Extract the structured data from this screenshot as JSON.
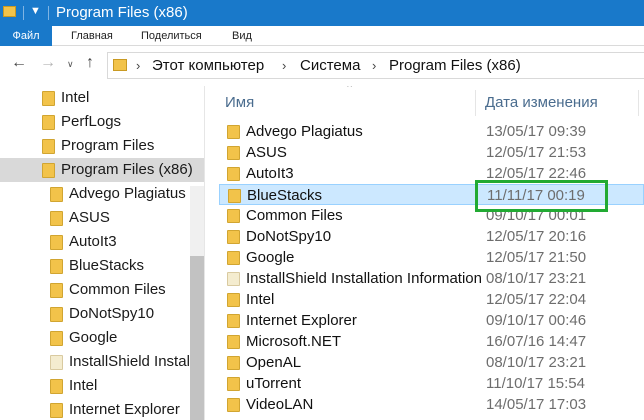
{
  "window": {
    "title": "Program Files (x86)"
  },
  "ribbon": {
    "tabs": [
      "Файл",
      "Главная",
      "Поделиться",
      "Вид"
    ]
  },
  "address": {
    "crumbs": [
      "Этот компьютер",
      "Система",
      "Program Files (x86)"
    ]
  },
  "nav_pane": {
    "items": [
      {
        "label": "Intel",
        "level": 0,
        "icon": "folder-icon"
      },
      {
        "label": "PerfLogs",
        "level": 0,
        "icon": "folder-icon"
      },
      {
        "label": "Program Files",
        "level": 0,
        "icon": "folder-icon"
      },
      {
        "label": "Program Files (x86)",
        "level": 0,
        "icon": "folder-icon",
        "selected": true
      },
      {
        "label": "Advego Plagiatus",
        "level": 1,
        "icon": "folder-icon"
      },
      {
        "label": "ASUS",
        "level": 1,
        "icon": "folder-icon"
      },
      {
        "label": "AutoIt3",
        "level": 1,
        "icon": "folder-icon"
      },
      {
        "label": "BlueStacks",
        "level": 1,
        "icon": "folder-icon"
      },
      {
        "label": "Common Files",
        "level": 1,
        "icon": "folder-icon"
      },
      {
        "label": "DoNotSpy10",
        "level": 1,
        "icon": "folder-icon"
      },
      {
        "label": "Google",
        "level": 1,
        "icon": "folder-icon"
      },
      {
        "label": "InstallShield Installation Information",
        "level": 1,
        "icon": "document-folder-icon"
      },
      {
        "label": "Intel",
        "level": 1,
        "icon": "folder-icon"
      },
      {
        "label": "Internet Explorer",
        "level": 1,
        "icon": "folder-icon"
      }
    ]
  },
  "file_list": {
    "columns": {
      "name": "Имя",
      "date": "Дата изменения"
    },
    "rows": [
      {
        "name": "Advego Plagiatus",
        "date": "13/05/17 09:39",
        "icon": "folder-icon"
      },
      {
        "name": "ASUS",
        "date": "12/05/17 21:53",
        "icon": "folder-icon"
      },
      {
        "name": "AutoIt3",
        "date": "12/05/17 22:46",
        "icon": "folder-icon"
      },
      {
        "name": "BlueStacks",
        "date": "11/11/17 00:19",
        "icon": "folder-icon",
        "selected": true
      },
      {
        "name": "Common Files",
        "date": "09/10/17 00:01",
        "icon": "folder-icon"
      },
      {
        "name": "DoNotSpy10",
        "date": "12/05/17 20:16",
        "icon": "folder-icon"
      },
      {
        "name": "Google",
        "date": "12/05/17 21:50",
        "icon": "folder-icon"
      },
      {
        "name": "InstallShield Installation Information",
        "date": "08/10/17 23:21",
        "icon": "document-folder-icon"
      },
      {
        "name": "Intel",
        "date": "12/05/17 22:04",
        "icon": "folder-icon"
      },
      {
        "name": "Internet Explorer",
        "date": "09/10/17 00:46",
        "icon": "folder-icon"
      },
      {
        "name": "Microsoft.NET",
        "date": "16/07/16 14:47",
        "icon": "folder-icon"
      },
      {
        "name": "OpenAL",
        "date": "08/10/17 23:21",
        "icon": "folder-icon"
      },
      {
        "name": "uTorrent",
        "date": "11/10/17 15:54",
        "icon": "folder-icon"
      },
      {
        "name": "VideoLAN",
        "date": "14/05/17 17:03",
        "icon": "folder-icon"
      }
    ]
  },
  "colors": {
    "titlebar": "#1979ca",
    "selection": "#cce8ff",
    "highlight_box": "#22aa33"
  }
}
